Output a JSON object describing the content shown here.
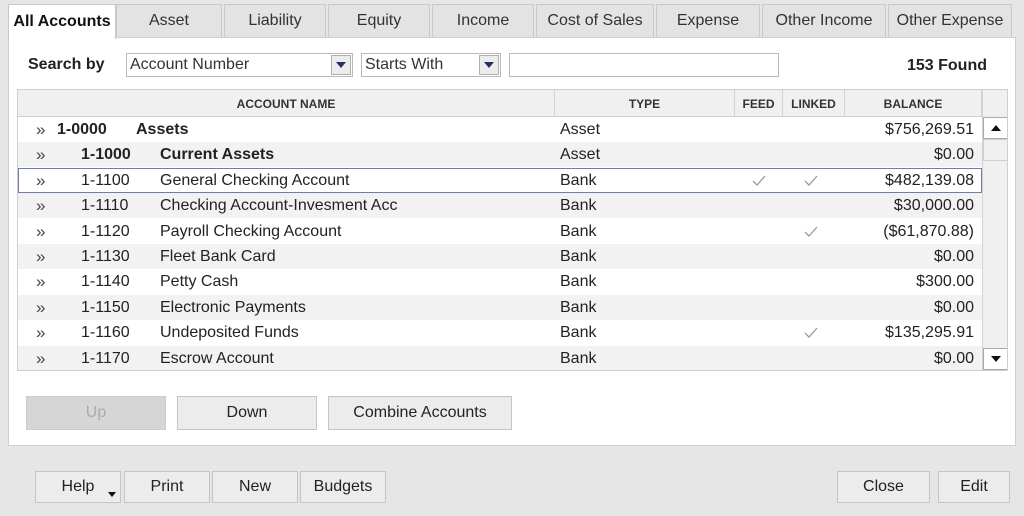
{
  "tabs": [
    {
      "label": "All Accounts",
      "active": true
    },
    {
      "label": "Asset",
      "active": false
    },
    {
      "label": "Liability",
      "active": false
    },
    {
      "label": "Equity",
      "active": false
    },
    {
      "label": "Income",
      "active": false
    },
    {
      "label": "Cost of Sales",
      "active": false
    },
    {
      "label": "Expense",
      "active": false
    },
    {
      "label": "Other Income",
      "active": false
    },
    {
      "label": "Other Expense",
      "active": false
    }
  ],
  "search": {
    "label": "Search by",
    "field": "Account Number",
    "mode": "Starts With",
    "query": "",
    "found": "153 Found"
  },
  "table": {
    "headers": {
      "name": "ACCOUNT NAME",
      "type": "TYPE",
      "feed": "FEED",
      "linked": "LINKED",
      "balance": "BALANCE"
    },
    "expand_glyph": "»",
    "rows": [
      {
        "number": "1-0000",
        "name": "Assets",
        "type": "Asset",
        "feed": false,
        "linked": false,
        "balance": "$756,269.51",
        "level": 0,
        "header": true
      },
      {
        "number": "1-1000",
        "name": "Current Assets",
        "type": "Asset",
        "feed": false,
        "linked": false,
        "balance": "$0.00",
        "level": 1,
        "header": true
      },
      {
        "number": "1-1100",
        "name": "General Checking Account",
        "type": "Bank",
        "feed": true,
        "linked": true,
        "balance": "$482,139.08",
        "level": 1,
        "header": false,
        "selected": true
      },
      {
        "number": "1-1110",
        "name": "Checking Account-Invesment Acc",
        "type": "Bank",
        "feed": false,
        "linked": false,
        "balance": "$30,000.00",
        "level": 1,
        "header": false
      },
      {
        "number": "1-1120",
        "name": "Payroll Checking Account",
        "type": "Bank",
        "feed": false,
        "linked": true,
        "balance": "($61,870.88)",
        "level": 1,
        "header": false
      },
      {
        "number": "1-1130",
        "name": "Fleet Bank Card",
        "type": "Bank",
        "feed": false,
        "linked": false,
        "balance": "$0.00",
        "level": 1,
        "header": false
      },
      {
        "number": "1-1140",
        "name": "Petty Cash",
        "type": "Bank",
        "feed": false,
        "linked": false,
        "balance": "$300.00",
        "level": 1,
        "header": false
      },
      {
        "number": "1-1150",
        "name": "Electronic Payments",
        "type": "Bank",
        "feed": false,
        "linked": false,
        "balance": "$0.00",
        "level": 1,
        "header": false
      },
      {
        "number": "1-1160",
        "name": "Undeposited Funds",
        "type": "Bank",
        "feed": false,
        "linked": true,
        "balance": "$135,295.91",
        "level": 1,
        "header": false
      },
      {
        "number": "1-1170",
        "name": "Escrow Account",
        "type": "Bank",
        "feed": false,
        "linked": false,
        "balance": "$0.00",
        "level": 1,
        "header": false
      }
    ]
  },
  "panel_buttons": {
    "up": "Up",
    "down": "Down",
    "combine": "Combine Accounts"
  },
  "footer": {
    "help": "Help",
    "print": "Print",
    "new": "New",
    "budgets": "Budgets",
    "close": "Close",
    "edit": "Edit"
  },
  "icons": {
    "expand": "double-chevron-right-icon",
    "check": "check-icon",
    "scroll_up": "arrow-up-icon",
    "scroll_down": "arrow-down-icon",
    "dropdown": "chevron-down-icon"
  },
  "colors": {
    "dropdown_arrow": "#1f2f6a",
    "selected_outline": "#6d7fa8",
    "check": "#9a9a9a"
  }
}
